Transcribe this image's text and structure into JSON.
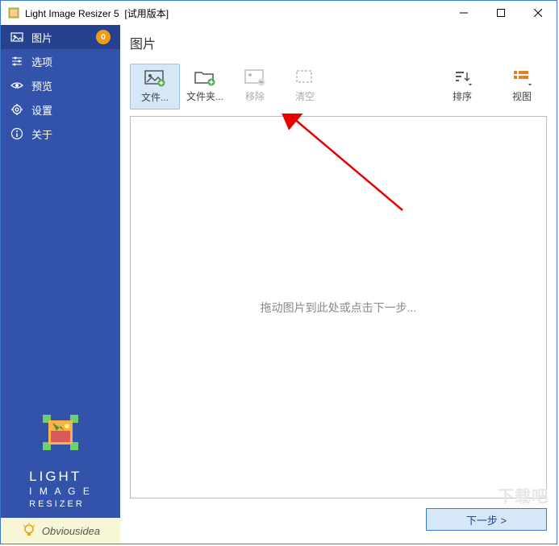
{
  "titlebar": {
    "app_name": "Light Image Resizer 5",
    "suffix": "[试用版本]"
  },
  "sidebar": {
    "items": [
      {
        "label": "图片",
        "badge": "0"
      },
      {
        "label": "选项"
      },
      {
        "label": "预览"
      },
      {
        "label": "设置"
      },
      {
        "label": "关于"
      }
    ],
    "logo_lines": {
      "l1": "LIGHT",
      "l2": "I M A G E",
      "l3": "RESIZER"
    },
    "footer": "Obviousidea"
  },
  "main": {
    "title": "图片",
    "toolbar": {
      "add_file": "文件...",
      "add_folder": "文件夹...",
      "remove": "移除",
      "clear": "清空",
      "sort": "排序",
      "view": "视图"
    },
    "dropzone_text": "拖动图片到此处或点击下一步...",
    "next_btn": "下一步 >"
  },
  "watermark": "下载吧"
}
